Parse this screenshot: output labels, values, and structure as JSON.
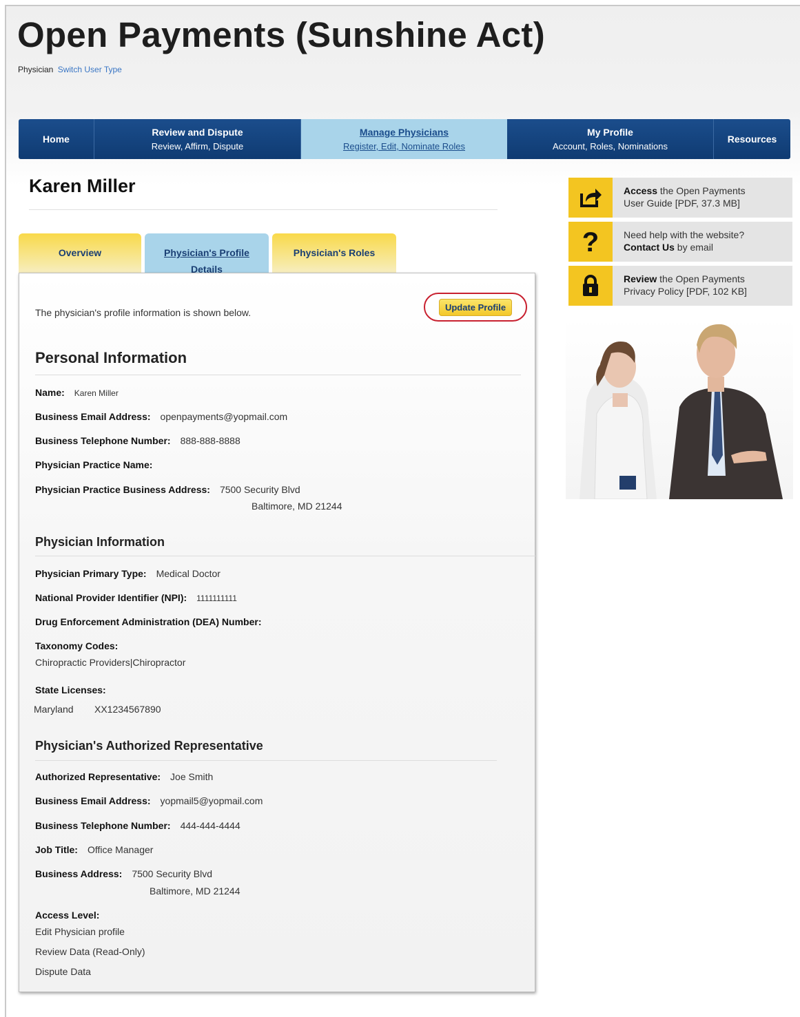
{
  "header": {
    "title": "Open Payments (Sunshine Act)",
    "user_type": "Physician",
    "switch_link": "Switch User Type"
  },
  "nav": [
    {
      "main": "Home",
      "sub": ""
    },
    {
      "main": "Review and Dispute",
      "sub": "Review, Affirm, Dispute"
    },
    {
      "main": "Manage Physicians",
      "sub": "Register, Edit, Nominate Roles"
    },
    {
      "main": "My Profile",
      "sub": "Account, Roles, Nominations"
    },
    {
      "main": "Resources",
      "sub": ""
    }
  ],
  "page": {
    "person_name": "Karen Miller"
  },
  "tabs": {
    "overview": "Overview",
    "profile_line1": "Physician's Profile",
    "profile_line2": "Details",
    "roles": "Physician's Roles"
  },
  "panel": {
    "intro": "The physician's profile information is shown below.",
    "update_button": "Update Profile"
  },
  "personal": {
    "heading": "Personal Information",
    "name_label": "Name:",
    "name_value": "Karen Miller",
    "email_label": "Business Email Address:",
    "email_value": "openpayments@yopmail.com",
    "phone_label": "Business Telephone Number:",
    "phone_value": "888-888-8888",
    "practice_name_label": "Physician Practice Name:",
    "practice_address_label": "Physician Practice Business Address:",
    "practice_address_line1": "7500 Security Blvd",
    "practice_address_line2": "Baltimore, MD 21244"
  },
  "physician": {
    "heading": "Physician Information",
    "primary_type_label": "Physician Primary Type:",
    "primary_type_value": "Medical Doctor",
    "npi_label": "National Provider Identifier (NPI):",
    "npi_value": "1111111111",
    "dea_label": "Drug Enforcement Administration (DEA) Number:",
    "taxonomy_label": "Taxonomy Codes:",
    "taxonomy_value": "Chiropractic Providers|Chiropractor",
    "licenses_label": "State Licenses:",
    "license_state": "Maryland",
    "license_number": "XX1234567890"
  },
  "representative": {
    "heading": "Physician's Authorized Representative",
    "rep_label": "Authorized Representative:",
    "rep_value": "Joe Smith",
    "email_label": "Business Email Address:",
    "email_value": "yopmail5@yopmail.com",
    "phone_label": "Business Telephone Number:",
    "phone_value": "444-444-4444",
    "job_label": "Job Title:",
    "job_value": "Office Manager",
    "address_label": "Business Address:",
    "address_line1": "7500 Security Blvd",
    "address_line2": "Baltimore, MD 21244",
    "access_label": "Access Level:",
    "access_levels": [
      "Edit Physician profile",
      "Review Data (Read-Only)",
      "Dispute Data"
    ]
  },
  "sidebar": [
    {
      "bold": "Access",
      "rest1": " the Open Payments",
      "line2": "User Guide [PDF, 37.3 MB]",
      "icon": "share-arrow-icon"
    },
    {
      "line1": "Need help with the website?",
      "bold": "Contact Us",
      "rest2": " by email",
      "icon": "question-icon"
    },
    {
      "bold": "Review",
      "rest1": " the Open Payments",
      "line2": "Privacy Policy [PDF, 102 KB]",
      "icon": "lock-icon"
    }
  ],
  "colors": {
    "nav_blue": "#1b4d8c",
    "active_tab": "#a9d4ea",
    "accent_yellow": "#f3c521",
    "highlight_red": "#c8202f"
  }
}
